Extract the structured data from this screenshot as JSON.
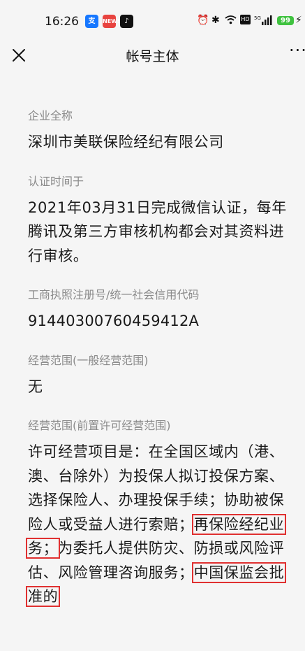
{
  "status_bar": {
    "time": "16:26",
    "app_icons": [
      "支",
      "抖"
    ],
    "right_icons_text": "⏰ ✱ ⌔ HD ⁵ᴳ▮",
    "battery": "99"
  },
  "nav": {
    "title": "帐号主体",
    "more": "···"
  },
  "sections": [
    {
      "label": "企业全称",
      "value": "深圳市美联保险经纪有限公司"
    },
    {
      "label": "认证时间于",
      "value": "2021年03月31日完成微信认证，每年腾讯及第三方审核机构都会对其资料进行审核。"
    },
    {
      "label": "工商执照注册号/统一社会信用代码",
      "value": "91440300760459412A"
    },
    {
      "label": "经营范围(一般经营范围)",
      "value": "无"
    },
    {
      "label": "经营范围(前置许可经营范围)",
      "value_parts": [
        "许可经营项目是：在全国区域内（港、澳、台除外）为投保人拟订投保方案、选择保险人、办理投保手续；协助被保险人或受益人进行索赔；",
        "再保险经纪业务；",
        "为委托人提供防灾、防损或风险评估、风险管理咨询服务；",
        "中国保监会批准的"
      ]
    }
  ],
  "colors": {
    "background": "#f5f5f5",
    "label": "#8a8a8a",
    "value": "#1a1a1a",
    "highlight": "#e03030",
    "battery": "#3fc23f"
  }
}
